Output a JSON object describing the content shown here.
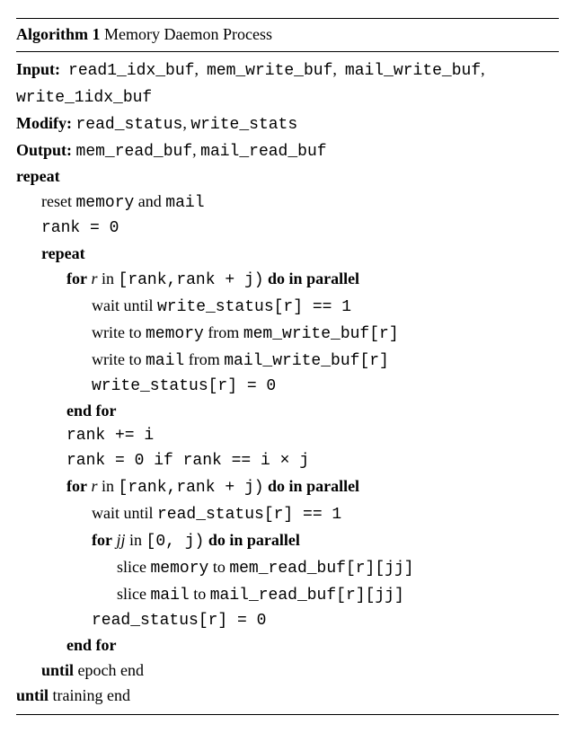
{
  "algo": {
    "num": "Algorithm 1",
    "title": "Memory Daemon Process",
    "iolabels": {
      "input": "Input:",
      "modify": "Modify:",
      "output": "Output:"
    },
    "input_items": [
      "read1_idx_buf",
      "mem_write_buf",
      "mail_write_buf",
      "write_1idx_buf"
    ],
    "modify_items": [
      "read_status",
      "write_stats"
    ],
    "output_items": [
      "mem_read_buf",
      "mail_read_buf"
    ],
    "kw": {
      "repeat": "repeat",
      "for": "for",
      "in": "in",
      "doinpar": "do in parallel",
      "endfor": "end for",
      "until": "until"
    },
    "prose": {
      "reset": "reset ",
      "and": " and ",
      "waituntil": "wait until ",
      "writeto": "write to ",
      "from": " from ",
      "sliceto": " to ",
      "epoch_end": "epoch end",
      "training_end": "training end"
    },
    "sym": {
      "rank_eq_0": "rank = 0",
      "r": "r",
      "rank_range": "[rank,rank + j)",
      "ws_chk": "write_status[r] == 1",
      "memory": "memory",
      "mail": "mail",
      "mw": "mem_write_buf[r]",
      "mlw": "mail_write_buf[r]",
      "ws_set": "write_status[r] = 0",
      "rank_inc": "rank += i",
      "rank_reset": "rank = 0 if rank == i × j",
      "rs_chk": "read_status[r] == 1",
      "jj": "jj",
      "j_range": "[0, j)",
      "slice": "slice ",
      "mrb": "mem_read_buf[r][jj]",
      "mlrb": "mail_read_buf[r][jj]",
      "rs_set": "read_status[r] = 0"
    }
  }
}
